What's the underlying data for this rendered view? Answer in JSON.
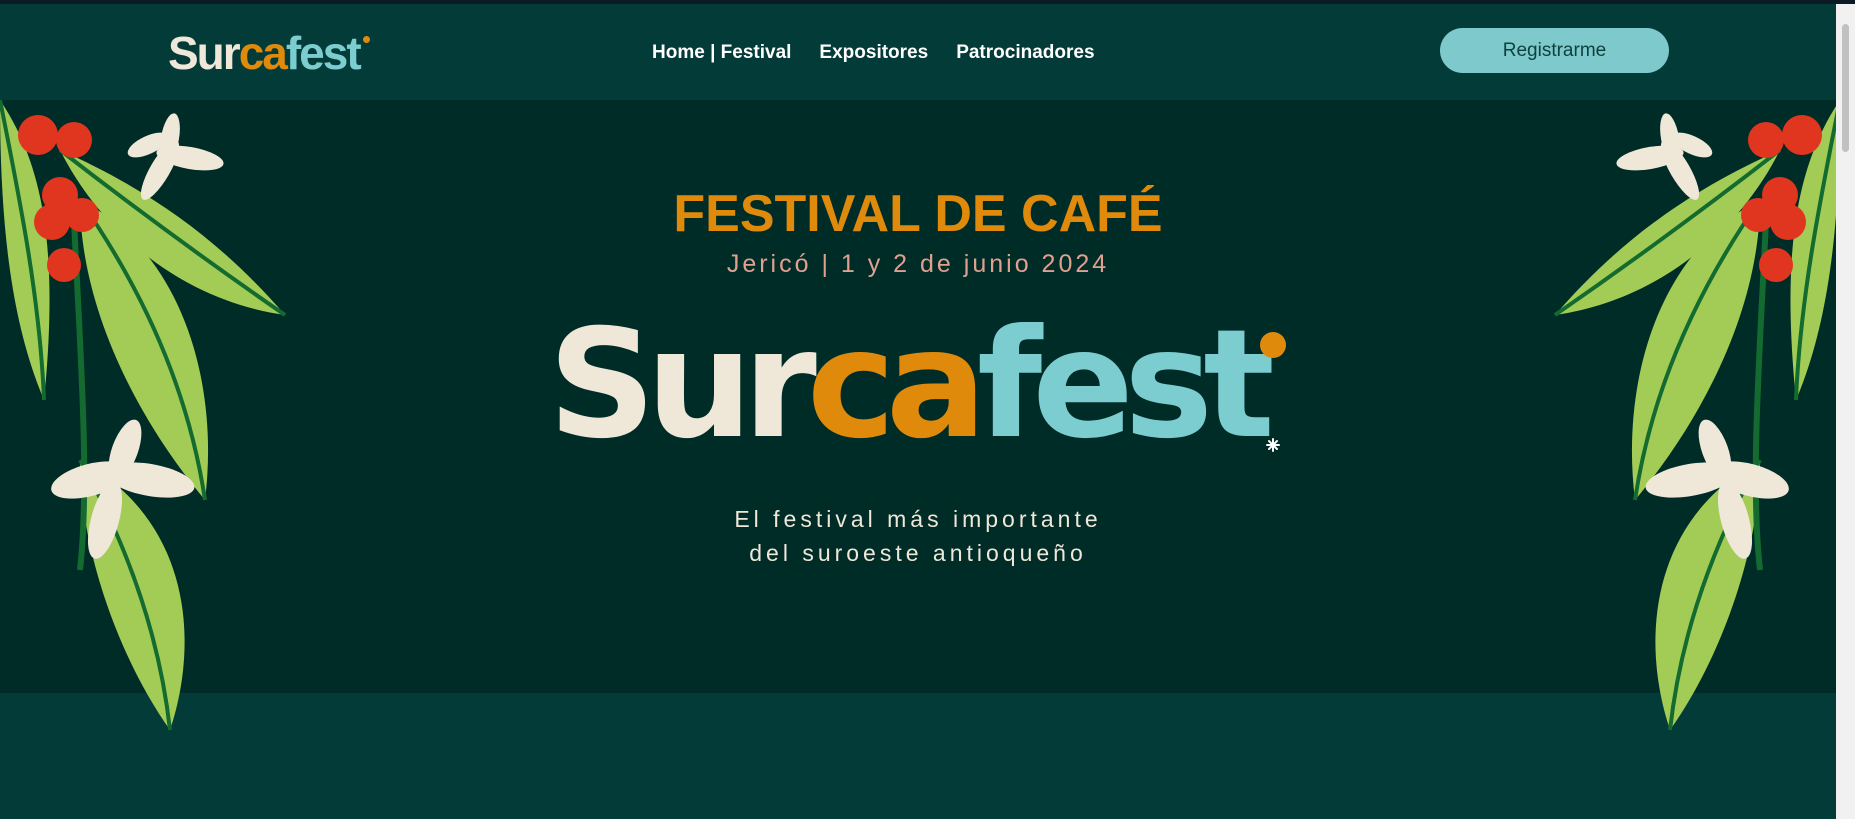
{
  "colors": {
    "header_bg": "#033b39",
    "hero_bg": "#002c28",
    "orange": "#e08a0c",
    "cream": "#efe7d8",
    "teal": "#7ccdd0",
    "salmon": "#e0a090",
    "button_bg": "#7dc9cb",
    "leaf": "#a3cc56",
    "vein": "#146b30",
    "berry": "#e0361f"
  },
  "header": {
    "logo": {
      "part1": "Sur",
      "part2": "ca",
      "part3": "fest"
    },
    "nav": [
      "Home | Festival",
      "Expositores",
      "Patrocinadores"
    ],
    "register_label": "Registrarme"
  },
  "hero": {
    "title": "FESTIVAL DE CAFÉ",
    "date": "Jericó | 1 y 2 de junio 2024",
    "logo": {
      "part1": "Sur",
      "part2": "ca",
      "part3": "fest"
    },
    "tagline_line1": "El festival más importante",
    "tagline_line2": "del suroeste antioqueño"
  }
}
